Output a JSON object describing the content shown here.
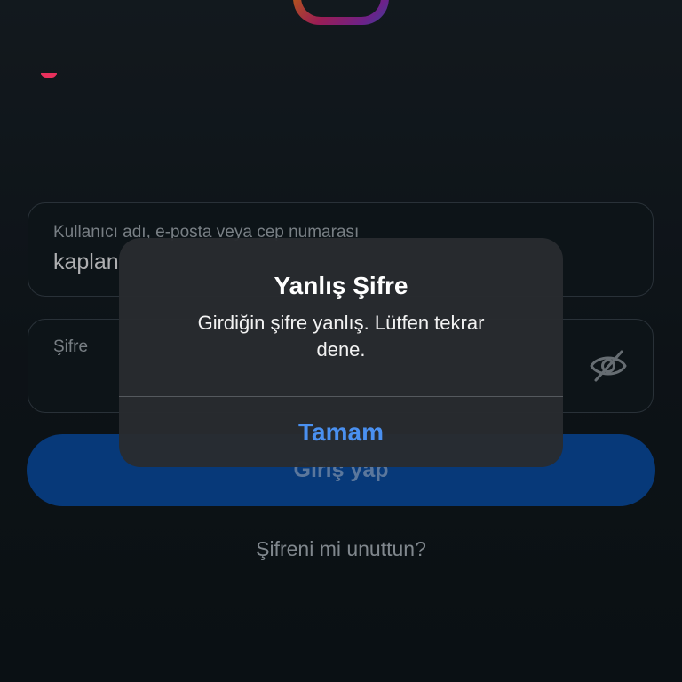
{
  "login": {
    "username_label": "Kullanıcı adı, e-posta veya cep numarası",
    "username_value": "kaplan",
    "password_label": "Şifre",
    "login_button": "Giriş yap",
    "forgot_password": "Şifreni mi unuttun?"
  },
  "alert": {
    "title": "Yanlış Şifre",
    "message": "Girdiğin şifre yanlış. Lütfen tekrar dene.",
    "ok_button": "Tamam"
  },
  "icons": {
    "logo": "instagram-logo-icon",
    "password_toggle": "eye-slash-icon"
  },
  "colors": {
    "background": "#121a20",
    "primary_button": "#0a4fa8",
    "alert_action": "#4a90f0"
  }
}
